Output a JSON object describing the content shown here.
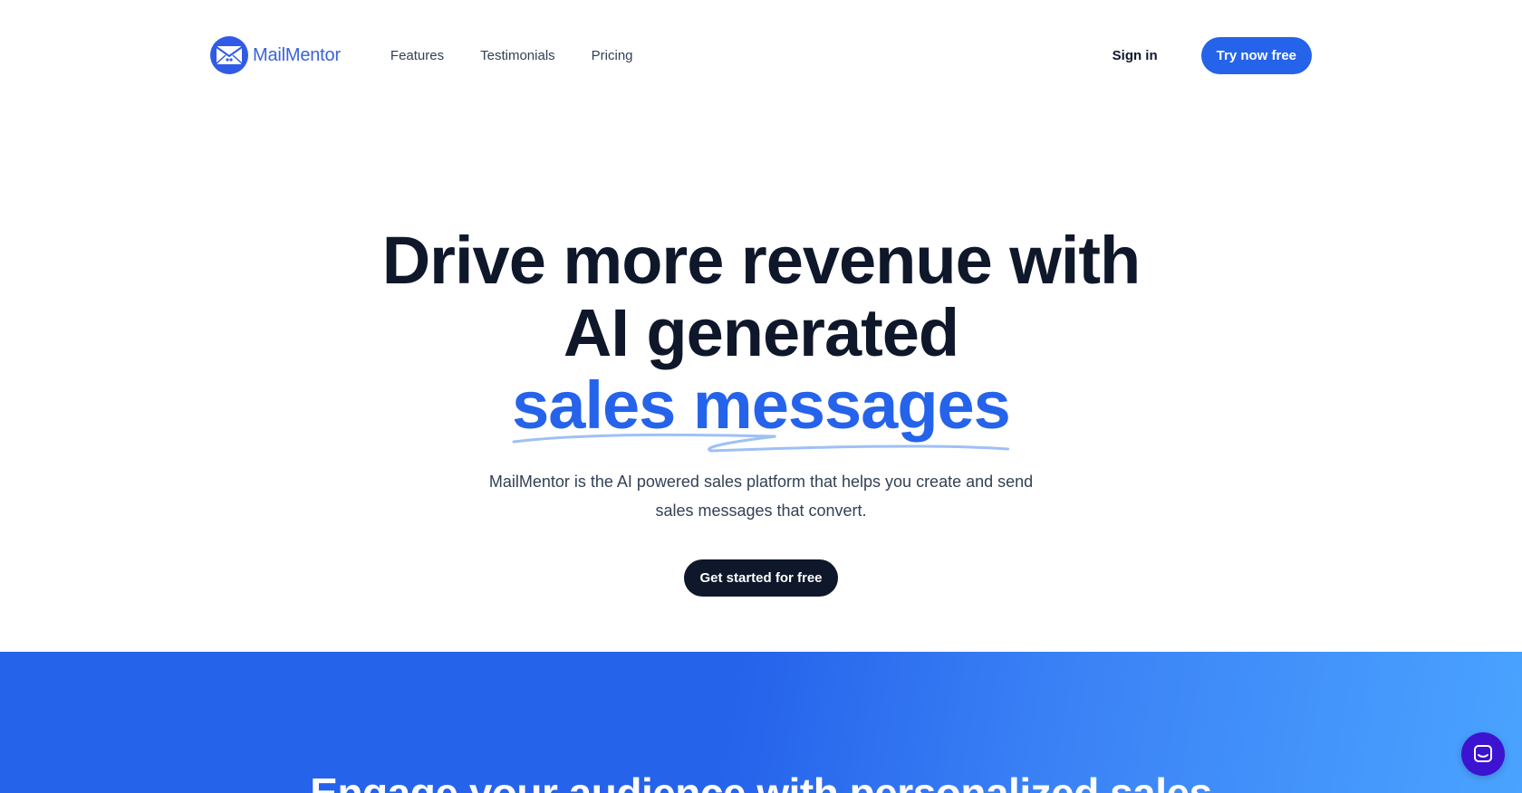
{
  "brand": {
    "name": "MailMentor"
  },
  "nav": {
    "items": [
      "Features",
      "Testimonials",
      "Pricing"
    ]
  },
  "header": {
    "signin_label": "Sign in",
    "cta_label": "Try now free"
  },
  "hero": {
    "title_line1": "Drive more revenue with",
    "title_line2": "AI generated",
    "title_highlight": "sales messages",
    "subtitle": "MailMentor is the AI powered sales platform that helps you create and send sales messages that convert.",
    "cta_label": "Get started for free"
  },
  "band": {
    "title": "Engage your audience with personalized sales"
  },
  "colors": {
    "primary": "#2563eb",
    "dark": "#0f172a",
    "chat": "#3b13d1"
  },
  "icons": {
    "logo": "envelope-icon",
    "chat": "chat-icon"
  }
}
